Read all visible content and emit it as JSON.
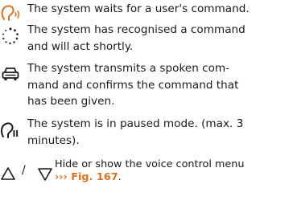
{
  "items": [
    {
      "icon": "voice-waiting-icon",
      "icon_color": "#e0701a",
      "lines": [
        "The system waits for a user's command."
      ]
    },
    {
      "icon": "processing-spinner-icon",
      "lines": [
        "The system has recognised a command",
        "and will act shortly."
      ]
    },
    {
      "icon": "car-icon",
      "lines": [
        "The system transmits a spoken com-",
        "mand and confirms the command that",
        "has been given."
      ]
    },
    {
      "icon": "voice-paused-icon",
      "lines": [
        "The system is in paused mode. (max. 3",
        "minutes)."
      ]
    },
    {
      "icon": "triangle-up-down-icon",
      "separator": "/",
      "lines": [
        "Hide or show the voice control menu"
      ],
      "reference": "››› Fig. 167",
      "reference_suffix": "."
    }
  ],
  "colors": {
    "accent": "#e0701a",
    "text": "#1a1a1a"
  }
}
